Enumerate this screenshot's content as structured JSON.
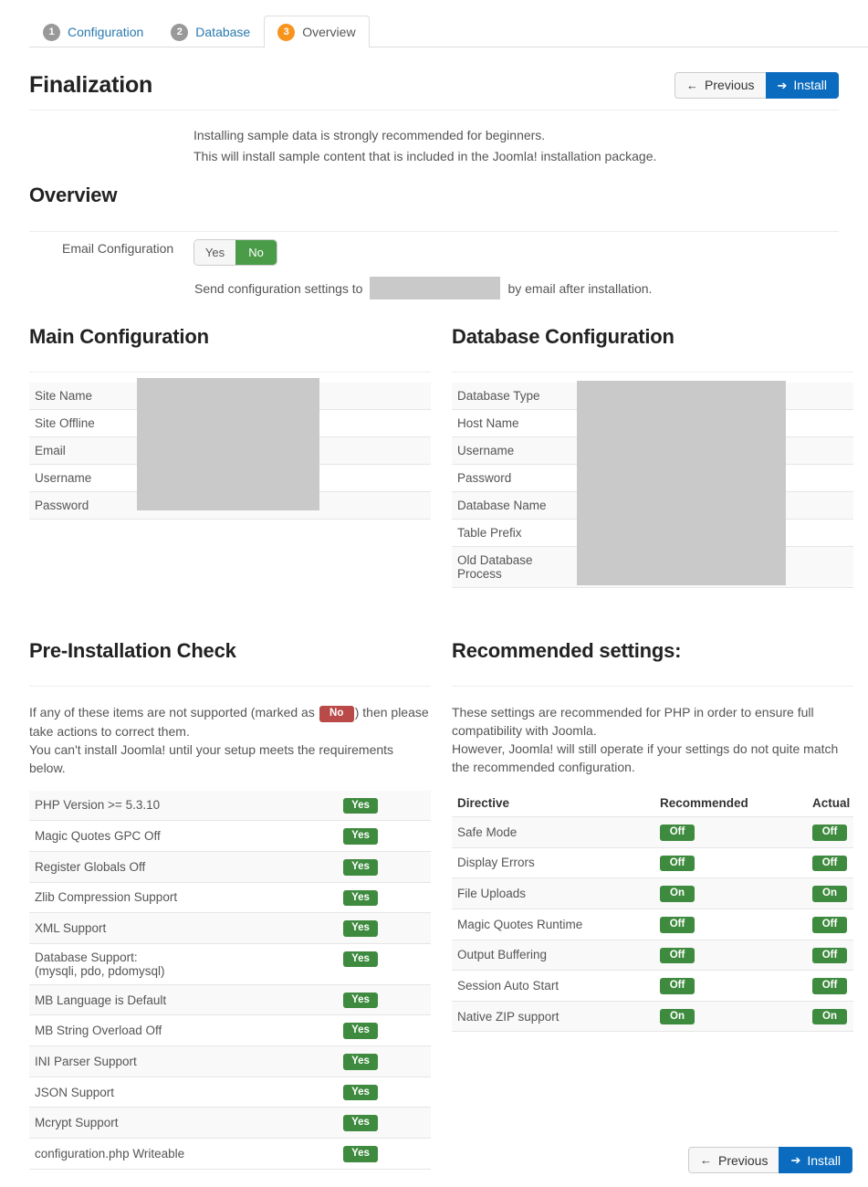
{
  "wizard": {
    "tabs": [
      {
        "num": "1",
        "label": "Configuration",
        "active": false
      },
      {
        "num": "2",
        "label": "Database",
        "active": false
      },
      {
        "num": "3",
        "label": "Overview",
        "active": true
      }
    ]
  },
  "toolbar": {
    "previous_label": "Previous",
    "install_label": "Install",
    "previous_icon": "arrow-left-icon",
    "install_icon": "arrow-right-icon",
    "previous_arrow": "←",
    "install_arrow": "➔"
  },
  "finalization": {
    "title": "Finalization",
    "intro_line1": "Installing sample data is strongly recommended for beginners.",
    "intro_line2": "This will install sample content that is included in the Joomla! installation package."
  },
  "overview": {
    "title": "Overview",
    "email_configuration_label": "Email Configuration",
    "yes_label": "Yes",
    "no_label": "No",
    "selected": "No",
    "send_prefix": "Send configuration settings to",
    "send_suffix": "by email after installation.",
    "email_value": ""
  },
  "main_configuration": {
    "title": "Main Configuration",
    "rows": [
      {
        "key": "Site Name",
        "value": ""
      },
      {
        "key": "Site Offline",
        "value": ""
      },
      {
        "key": "Email",
        "value": ""
      },
      {
        "key": "Username",
        "value": ""
      },
      {
        "key": "Password",
        "value": ""
      }
    ]
  },
  "database_configuration": {
    "title": "Database Configuration",
    "rows": [
      {
        "key": "Database Type",
        "value": ""
      },
      {
        "key": "Host Name",
        "value": ""
      },
      {
        "key": "Username",
        "value": ""
      },
      {
        "key": "Password",
        "value": ""
      },
      {
        "key": "Database Name",
        "value": ""
      },
      {
        "key": "Table Prefix",
        "value": ""
      },
      {
        "key": "Old Database Process",
        "value": ""
      }
    ]
  },
  "pre_installation_check": {
    "title": "Pre-Installation Check",
    "desc_part1": "If any of these items are not supported (marked as",
    "desc_no_badge": "No",
    "desc_part2": ") then please take actions to correct them.",
    "desc_line2": "You can't install Joomla! until your setup meets the requirements below.",
    "rows": [
      {
        "label": "PHP Version >= 5.3.10",
        "status": "Yes"
      },
      {
        "label": "Magic Quotes GPC Off",
        "status": "Yes"
      },
      {
        "label": "Register Globals Off",
        "status": "Yes"
      },
      {
        "label": "Zlib Compression Support",
        "status": "Yes"
      },
      {
        "label": "XML Support",
        "status": "Yes"
      },
      {
        "label": "Database Support:\n(mysqli, pdo, pdomysql)",
        "status": "Yes"
      },
      {
        "label": "MB Language is Default",
        "status": "Yes"
      },
      {
        "label": "MB String Overload Off",
        "status": "Yes"
      },
      {
        "label": "INI Parser Support",
        "status": "Yes"
      },
      {
        "label": "JSON Support",
        "status": "Yes"
      },
      {
        "label": "Mcrypt Support",
        "status": "Yes"
      },
      {
        "label": "configuration.php Writeable",
        "status": "Yes"
      }
    ]
  },
  "recommended_settings": {
    "title": "Recommended settings:",
    "desc_line1": "These settings are recommended for PHP in order to ensure full compatibility with Joomla.",
    "desc_line2": "However, Joomla! will still operate if your settings do not quite match the recommended configuration.",
    "headers": {
      "directive": "Directive",
      "recommended": "Recommended",
      "actual": "Actual"
    },
    "rows": [
      {
        "directive": "Safe Mode",
        "recommended": "Off",
        "actual": "Off"
      },
      {
        "directive": "Display Errors",
        "recommended": "Off",
        "actual": "Off"
      },
      {
        "directive": "File Uploads",
        "recommended": "On",
        "actual": "On"
      },
      {
        "directive": "Magic Quotes Runtime",
        "recommended": "Off",
        "actual": "Off"
      },
      {
        "directive": "Output Buffering",
        "recommended": "Off",
        "actual": "Off"
      },
      {
        "directive": "Session Auto Start",
        "recommended": "Off",
        "actual": "Off"
      },
      {
        "directive": "Native ZIP support",
        "recommended": "On",
        "actual": "On"
      }
    ]
  },
  "colors": {
    "accent_orange": "#f7941d",
    "link_blue": "#2a7ab0",
    "install_blue": "#0b6cbf",
    "badge_green": "#3e8a3e",
    "badge_red": "#b94a48",
    "toggle_green": "#4a9c49",
    "redaction_gray": "#c9c9c9"
  }
}
